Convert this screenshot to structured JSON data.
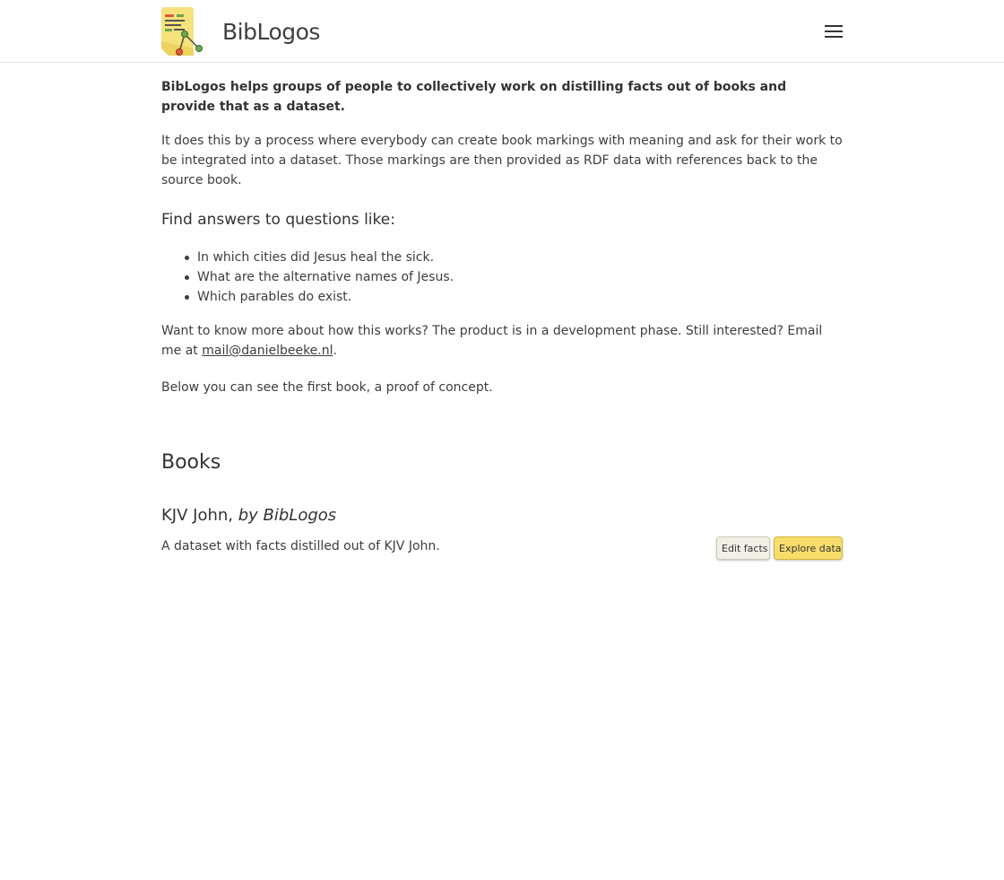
{
  "header": {
    "brand_name": "BibLogos",
    "logo_icon": "biblogos-logo-icon",
    "menu_icon": "hamburger-menu-icon"
  },
  "intro": {
    "lead": "BibLogos helps groups of people to collectively work on distilling facts out of books and provide that as a dataset.",
    "process": "It does this by a process where everybody can create book markings with meaning and ask for their work to be integrated into a dataset. Those markings are then provided as RDF data with references back to the source book."
  },
  "questions": {
    "heading": "Find answers to questions like:",
    "items": [
      "In which cities did Jesus heal the sick.",
      "What are the alternative names of Jesus.",
      "Which parables do exist."
    ]
  },
  "contact": {
    "text_before": "Want to know more about how this works? The product is in a development phase. Still interested? Email me at ",
    "email": "mail@danielbeeke.nl",
    "text_after": "."
  },
  "below_text": "Below you can see the first book, a proof of concept.",
  "books": {
    "heading": "Books",
    "items": [
      {
        "title": "KJV John,",
        "author": "by BibLogos",
        "description": "A dataset with facts distilled out of KJV John.",
        "edit_label": "Edit facts",
        "explore_label": "Explore data"
      }
    ]
  },
  "colors": {
    "explore_button": "#f8dd6b",
    "edit_button": "#f1efe6",
    "text": "#3d3d3d"
  }
}
